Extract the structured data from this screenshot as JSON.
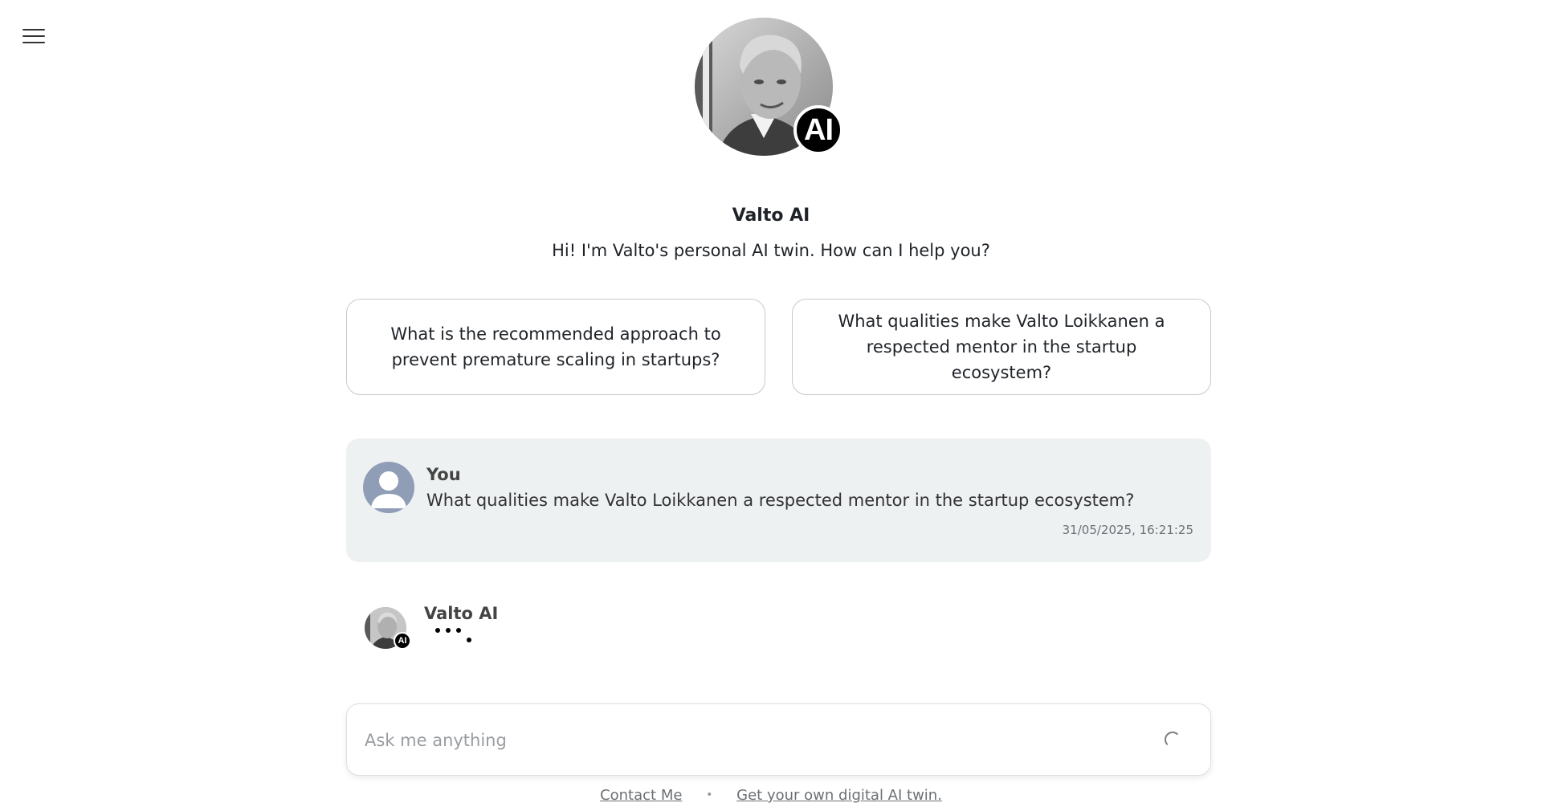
{
  "header": {
    "menu_icon": "hamburger-menu-icon",
    "avatar_badge": "AI",
    "name": "Valto AI",
    "greeting": "Hi! I'm Valto's personal AI twin. How can I help you?"
  },
  "suggestions": [
    {
      "label": "What is the recommended approach to prevent premature scaling in startups?"
    },
    {
      "label": "What qualities make Valto Loikkanen a respected mentor in the startup ecosystem?"
    }
  ],
  "conversation": {
    "user_message": {
      "sender": "You",
      "text": "What qualities make Valto Loikkanen a respected mentor in the startup ecosystem?",
      "timestamp": "31/05/2025, 16:21:25"
    },
    "ai_message": {
      "sender": "Valto AI",
      "badge": "AI",
      "status": "typing"
    }
  },
  "composer": {
    "placeholder": "Ask me anything",
    "value": "",
    "state_icon": "loading-spinner-icon"
  },
  "footer": {
    "contact_link": "Contact Me",
    "separator": "•",
    "promo_link": "Get your own digital AI twin."
  },
  "colors": {
    "background": "#ffffff",
    "user_bubble": "#eef1f2",
    "badge": "#000000",
    "user_avatar": "#8f9eb6",
    "muted_text": "#6b7075"
  }
}
